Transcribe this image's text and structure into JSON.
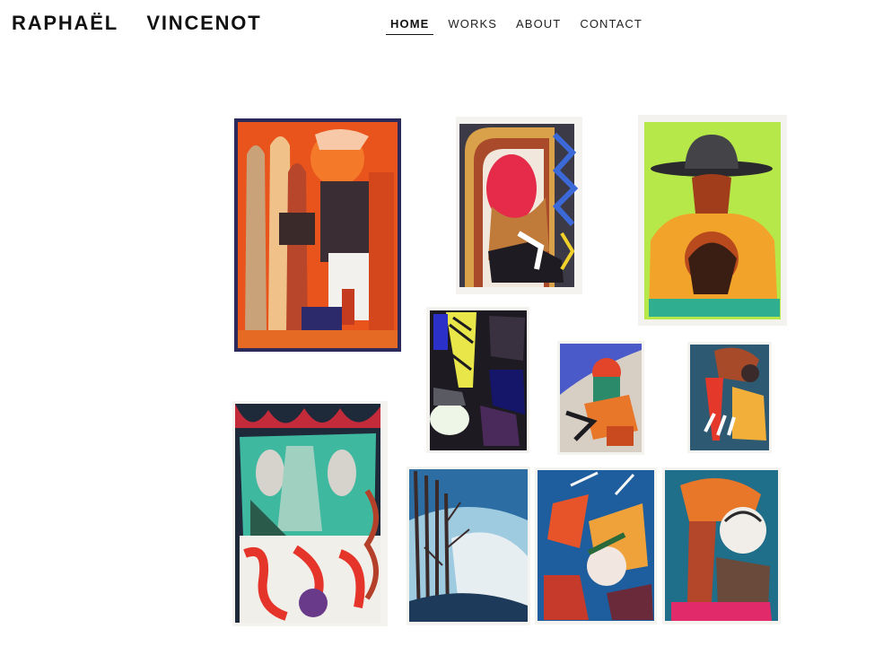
{
  "site": {
    "title": "RAPHAËL  VINCENOT"
  },
  "nav": {
    "items": [
      {
        "label": "HOME",
        "active": true
      },
      {
        "label": "WORKS",
        "active": false
      },
      {
        "label": "ABOUT",
        "active": false
      },
      {
        "label": "CONTACT",
        "active": false
      }
    ]
  },
  "colors": {
    "text": "#111111",
    "background": "#ffffff"
  }
}
